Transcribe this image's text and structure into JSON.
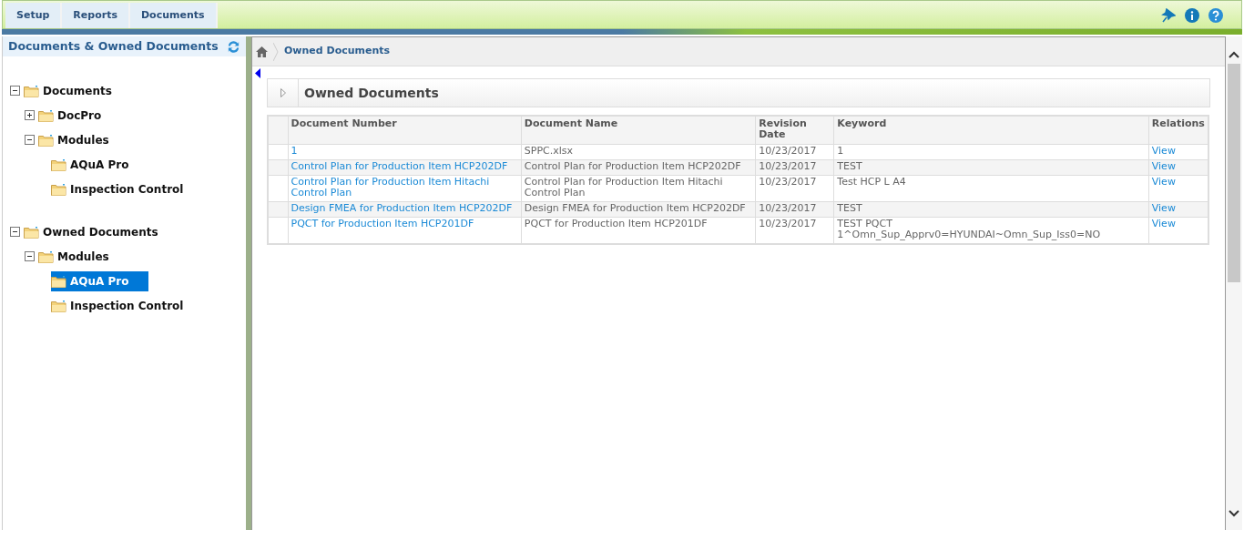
{
  "top_tabs": [
    {
      "label": "Setup"
    },
    {
      "label": "Reports"
    },
    {
      "label": "Documents"
    }
  ],
  "sidebar": {
    "title": "Documents & Owned Documents",
    "tree": [
      {
        "label": "Documents",
        "expanded": true,
        "selected": false,
        "children": [
          {
            "label": "DocPro",
            "expanded": false,
            "selected": false
          },
          {
            "label": "Modules",
            "expanded": true,
            "selected": false,
            "children": [
              {
                "label": "AQuA Pro",
                "selected": false
              },
              {
                "label": "Inspection Control",
                "selected": false
              }
            ]
          }
        ]
      },
      {
        "label": "Owned Documents",
        "expanded": true,
        "selected": false,
        "children": [
          {
            "label": "Modules",
            "expanded": true,
            "selected": false,
            "children": [
              {
                "label": "AQuA Pro",
                "selected": true
              },
              {
                "label": "Inspection Control",
                "selected": false
              }
            ]
          }
        ]
      }
    ]
  },
  "breadcrumb": [
    "Owned Documents"
  ],
  "panel": {
    "title": "Owned Documents",
    "columns": [
      "Document Number",
      "Document Name",
      "Revision Date",
      "Keyword",
      "Relations"
    ],
    "rows": [
      [
        "1",
        "SPPC.xlsx",
        "10/23/2017",
        "1",
        "View"
      ],
      [
        "Control Plan for Production Item HCP202DF",
        "Control Plan for Production Item HCP202DF",
        "10/23/2017",
        "TEST",
        "View"
      ],
      [
        "Control Plan for Production Item Hitachi Control Plan",
        "Control Plan for Production Item Hitachi Control Plan",
        "10/23/2017",
        "Test HCP L A4",
        "View"
      ],
      [
        "Design FMEA for Production Item HCP202DF",
        "Design FMEA for Production Item HCP202DF",
        "10/23/2017",
        "TEST",
        "View"
      ],
      [
        "PQCT for Production Item HCP201DF",
        "PQCT for Production Item HCP201DF",
        "10/23/2017",
        "TEST PQCT\n1^Omn_Sup_Apprv0=HYUNDAI~Omn_Sup_Iss0=NO",
        "View"
      ]
    ]
  }
}
